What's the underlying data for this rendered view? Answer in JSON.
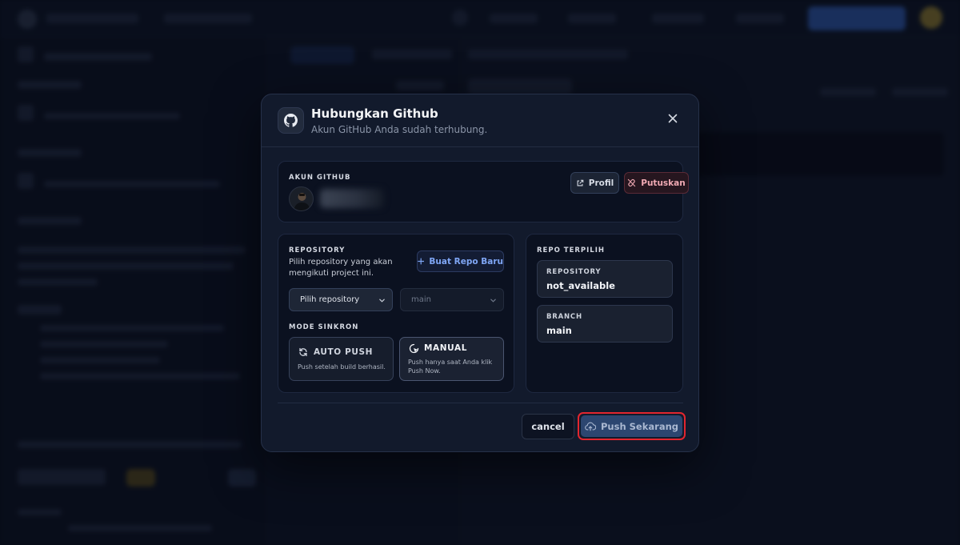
{
  "modal": {
    "title": "Hubungkan Github",
    "subtitle": "Akun GitHub Anda sudah terhubung.",
    "close_icon": "x-icon"
  },
  "account": {
    "label": "AKUN GITHUB",
    "profile_button": "Profil",
    "disconnect_button": "Putuskan"
  },
  "repository": {
    "label": "REPOSITORY",
    "description": "Pilih repository yang akan mengikuti project ini.",
    "new_repo_button": "Buat Repo Baru",
    "repo_select_value": "Pilih repository",
    "branch_select_value": "main",
    "sync_mode_label": "MODE SINKRON",
    "modes": [
      {
        "title": "AUTO PUSH",
        "description": "Push setelah build berhasil.",
        "icon": "refresh-icon"
      },
      {
        "title": "MANUAL",
        "description": "Push hanya saat Anda klik Push Now.",
        "icon": "pointer-click-icon"
      }
    ]
  },
  "selected": {
    "label": "REPO TERPILIH",
    "repository_key": "REPOSITORY",
    "repository_value": "not_available",
    "branch_key": "BRANCH",
    "branch_value": "main"
  },
  "footer": {
    "cancel_button": "cancel",
    "push_button": "Push Sekarang"
  },
  "colors": {
    "background": "#0c1222",
    "modal": "#121a2c",
    "accent_blue": "#7fa6f5",
    "danger": "#f0a9b3",
    "highlight_ring": "#e2262f"
  }
}
